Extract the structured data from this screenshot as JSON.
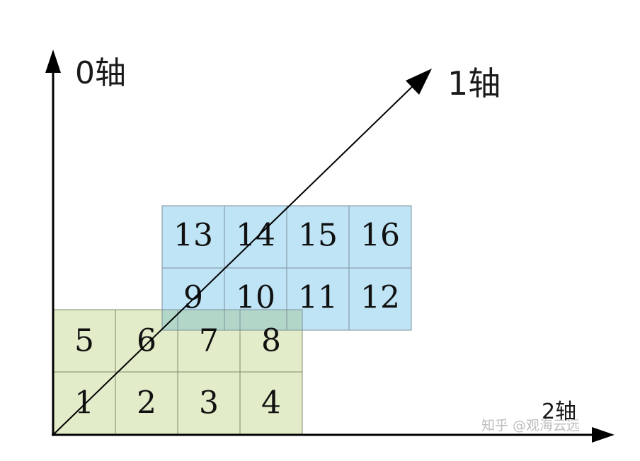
{
  "axes": {
    "axis0_label": "0轴",
    "axis1_label": "1轴",
    "axis2_label": "2轴"
  },
  "front_block": {
    "rows": [
      [
        "5",
        "6",
        "7",
        "8"
      ],
      [
        "1",
        "2",
        "3",
        "4"
      ]
    ]
  },
  "back_block": {
    "rows": [
      [
        "13",
        "14",
        "15",
        "16"
      ],
      [
        "9",
        "10",
        "11",
        "12"
      ]
    ]
  },
  "watermark": "知乎 @观海云远",
  "colors": {
    "front_fill": "#e2ecc9",
    "back_fill": "#bfe4f6",
    "overlap_fill": "#b2d7c9"
  }
}
